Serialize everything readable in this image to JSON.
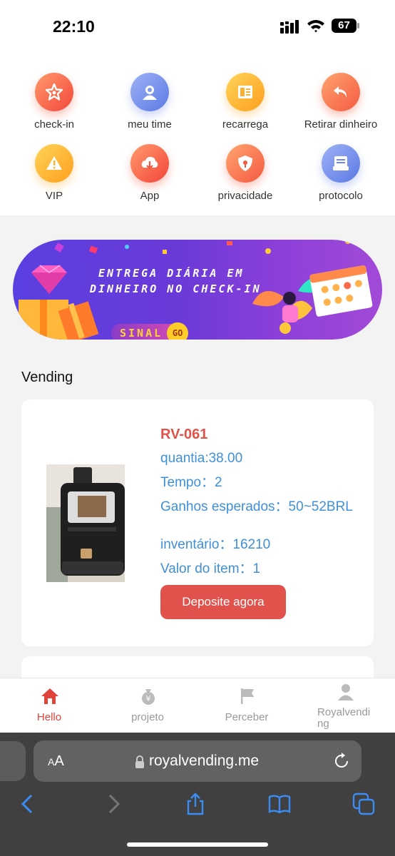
{
  "status": {
    "time": "22:10",
    "battery": "67"
  },
  "grid": [
    {
      "label": "check-in",
      "icon": "star-icon",
      "color": "red"
    },
    {
      "label": "meu time",
      "icon": "team-icon",
      "color": "blue"
    },
    {
      "label": "recarrega",
      "icon": "recharge-icon",
      "color": "yellow"
    },
    {
      "label": "Retirar dinheiro",
      "icon": "withdraw-icon",
      "color": "salmon"
    },
    {
      "label": "VIP",
      "icon": "warning-icon",
      "color": "yellow"
    },
    {
      "label": "App",
      "icon": "download-cloud-icon",
      "color": "red"
    },
    {
      "label": "privacidade",
      "icon": "shield-icon",
      "color": "salmon"
    },
    {
      "label": "protocolo",
      "icon": "document-icon",
      "color": "blue"
    }
  ],
  "banner": {
    "line1": "ENTREGA DIÁRIA EM",
    "line2": "DINHEIRO NO CHECK-IN",
    "badge": "SINAL",
    "badge_go": "GO"
  },
  "section_title": "Vending",
  "product": {
    "code": "RV-061",
    "quantia": "quantia:38.00",
    "tempo": "Tempo：2",
    "ganhos": "Ganhos esperados：50~52BRL",
    "inventario": "inventário：16210",
    "valor": "Valor do item：1",
    "button": "Deposite agora"
  },
  "tabs": [
    {
      "label": "Hello",
      "icon": "home-icon",
      "active": true
    },
    {
      "label": "projeto",
      "icon": "money-bag-icon",
      "active": false
    },
    {
      "label": "Perceber",
      "icon": "flag-icon",
      "active": false
    },
    {
      "label": "Royalvending",
      "icon": "user-icon",
      "active": false
    }
  ],
  "browser": {
    "aa_small": "A",
    "aa_big": "A",
    "url": "royalvending.me"
  },
  "colors": {
    "accent": "#e2524c",
    "link": "#3f8fd9",
    "tab_active": "#e0433a"
  }
}
